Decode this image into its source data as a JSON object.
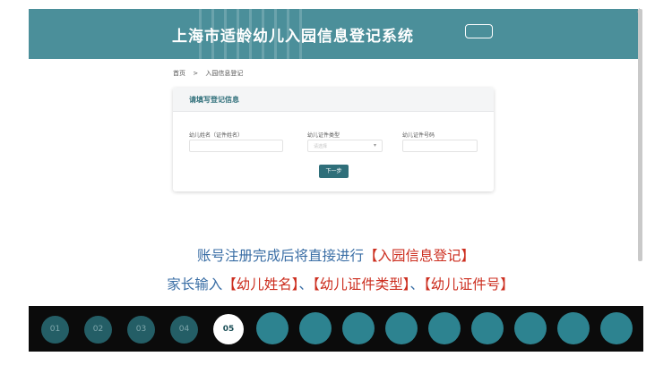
{
  "header": {
    "title": "上海市适龄幼儿入园信息登记系统"
  },
  "breadcrumb": {
    "home": "首页",
    "separator": ">",
    "current": "入园信息登记"
  },
  "form": {
    "title": "请填写登记信息",
    "name_label": "幼儿姓名（证件姓名）",
    "id_type_label": "幼儿证件类型",
    "id_type_placeholder": "请选择",
    "id_number_label": "幼儿证件号码",
    "next_button": "下一步"
  },
  "caption": {
    "line1_text": "账号注册完成后将直接进行",
    "line1_highlight": "【入园信息登记】",
    "line2_prefix": "家长输入",
    "line2_item1": "【幼儿姓名】",
    "sep1": "、",
    "line2_item2": "【幼儿证件类型】",
    "sep2": "、",
    "line2_item3": "【幼儿证件号】"
  },
  "steps": {
    "s1": "01",
    "s2": "02",
    "s3": "03",
    "s4": "04",
    "s5": "05",
    "current": "05"
  },
  "colors": {
    "header_bg": "#4b8f9a",
    "accent": "#2f6f7a",
    "caption": "#3a6ea5",
    "highlight": "#cc2e1f"
  }
}
